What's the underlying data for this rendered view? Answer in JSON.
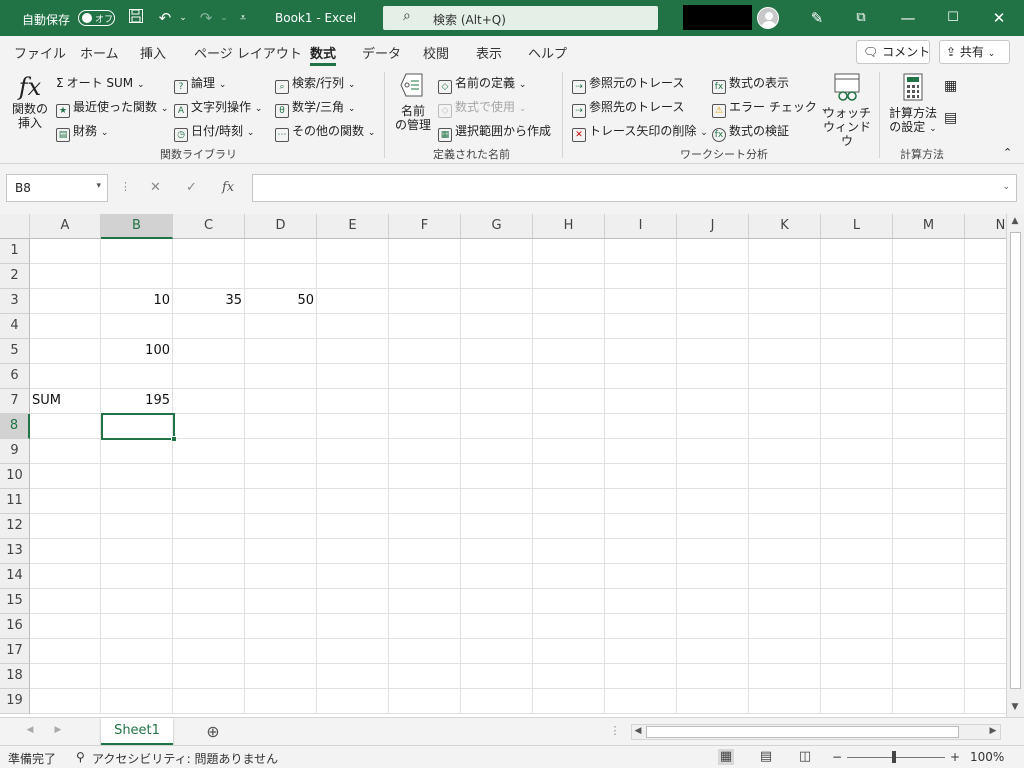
{
  "titlebar": {
    "autosave_label": "自動保存",
    "autosave_state": "オフ",
    "title": "Book1 - Excel",
    "search_placeholder": "検索 (Alt+Q)",
    "accent_color": "#217346"
  },
  "menu": {
    "tabs": [
      "ファイル",
      "ホーム",
      "挿入",
      "ページ レイアウト",
      "数式",
      "データ",
      "校閲",
      "表示",
      "ヘルプ"
    ],
    "active_tab": "数式",
    "comment_button": "コメント",
    "share_button": "共有"
  },
  "ribbon": {
    "function_library": {
      "insert_function": "関数の挿入",
      "autosum": "オート SUM",
      "recent": "最近使った関数",
      "financial": "財務",
      "logical": "論理",
      "text": "文字列操作",
      "datetime": "日付/時刻",
      "lookup": "検索/行列",
      "math": "数学/三角",
      "more": "その他の関数",
      "group_label": "関数ライブラリ"
    },
    "defined_names": {
      "name_manager_line1": "名前",
      "name_manager_line2": "の管理",
      "define_name": "名前の定義",
      "use_in_formula": "数式で使用",
      "create_from_selection": "選択範囲から作成",
      "group_label": "定義された名前"
    },
    "formula_auditing": {
      "trace_precedents": "参照元のトレース",
      "trace_dependents": "参照先のトレース",
      "remove_arrows": "トレース矢印の削除",
      "show_formulas": "数式の表示",
      "error_checking": "エラー チェック",
      "evaluate_formula": "数式の検証",
      "watch_window_line1": "ウォッチ",
      "watch_window_line2": "ウィンドウ",
      "group_label": "ワークシート分析"
    },
    "calculation": {
      "options_line1": "計算方法",
      "options_line2": "の設定",
      "group_label": "計算方法"
    }
  },
  "formula_bar": {
    "name_box": "B8",
    "fx_symbol": "fx",
    "formula": ""
  },
  "grid": {
    "columns": [
      "A",
      "B",
      "C",
      "D",
      "E",
      "F",
      "G",
      "H",
      "I",
      "J",
      "K",
      "L",
      "M",
      "N"
    ],
    "rows": [
      "1",
      "2",
      "3",
      "4",
      "5",
      "6",
      "7",
      "8",
      "9",
      "10",
      "11",
      "12",
      "13",
      "14",
      "15",
      "16",
      "17",
      "18",
      "19"
    ],
    "selected_column": "B",
    "selected_row": "8",
    "cells": {
      "B3": "10",
      "C3": "35",
      "D3": "50",
      "B5": "100",
      "A7": "SUM",
      "B7": "195"
    }
  },
  "sheets": {
    "tabs": [
      "Sheet1"
    ],
    "active": "Sheet1"
  },
  "status": {
    "ready": "準備完了",
    "accessibility": "アクセシビリティ: 問題ありません",
    "zoom": "100%"
  }
}
